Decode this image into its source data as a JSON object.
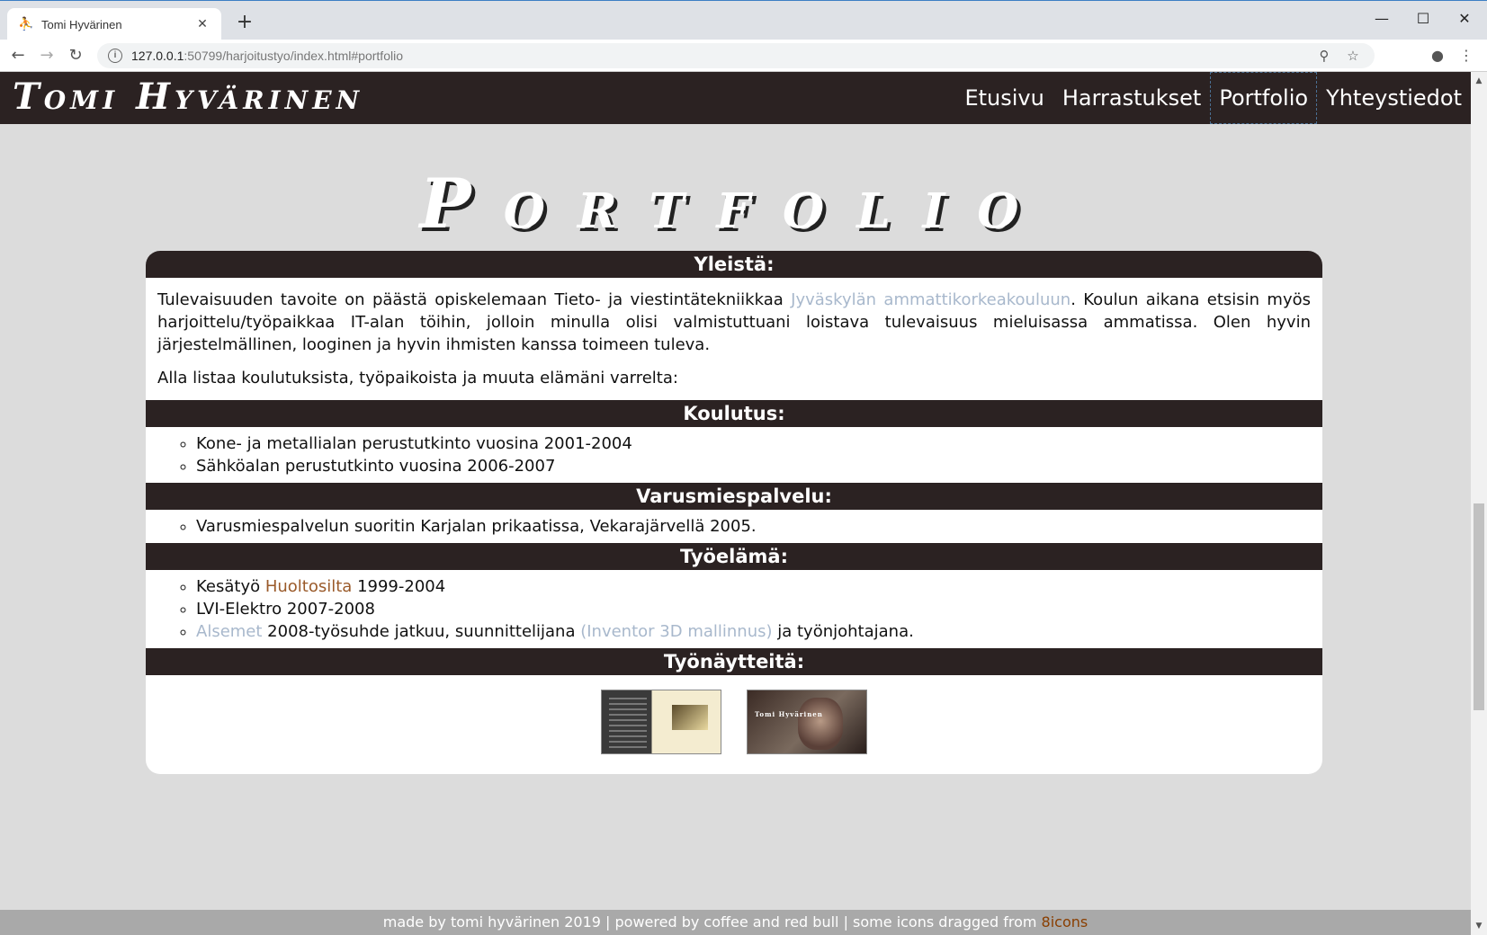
{
  "browser": {
    "tab_title": "Tomi Hyvärinen",
    "tab_close": "✕",
    "new_tab": "+",
    "url_host": "127.0.0.1",
    "url_rest": ":50799/harjoitustyo/index.html#portfolio",
    "info_glyph": "i",
    "icons": {
      "favicon": "runner-icon",
      "back": "arrow-left-icon",
      "forward": "arrow-right-icon",
      "reload": "reload-icon",
      "zoom": "zoom-icon",
      "bookmark": "star-icon",
      "profile": "account-icon",
      "menu": "kebab-menu-icon"
    },
    "glyphs": {
      "favicon": "⛹",
      "back": "←",
      "forward": "→",
      "reload": "↻",
      "zoom": "⚲",
      "bookmark": "☆",
      "profile": "●",
      "menu": "⋮",
      "minimize": "—",
      "maximize": "☐",
      "close": "✕",
      "scroll_up": "▲",
      "scroll_down": "▼"
    }
  },
  "site": {
    "logo": "Tomi Hyvärinen",
    "nav": [
      "Etusivu",
      "Harrastukset",
      "Portfolio",
      "Yhteystiedot"
    ],
    "active_nav": "Portfolio",
    "page_title": "Portfolio"
  },
  "sections": {
    "general": {
      "heading": "Yleistä:",
      "p1_before": "Tulevaisuuden tavoite on päästä opiskelemaan Tieto- ja viestintätekniikkaa ",
      "p1_link": "Jyväskylän ammattikorkeakouluun",
      "p1_after": ". Koulun aikana etsisin myös harjoittelu/työpaikkaa IT-alan töihin, jolloin minulla olisi valmistuttuani loistava tulevaisuus mieluisassa ammatissa. Olen hyvin järjestelmällinen, looginen ja hyvin ihmisten kanssa toimeen tuleva.",
      "p2": "Alla listaa koulutuksista, työpaikoista ja muuta elämäni varrelta:"
    },
    "education": {
      "heading": "Koulutus:",
      "items": [
        "Kone- ja metallialan perustutkinto vuosina 2001-2004",
        "Sähköalan perustutkinto vuosina 2006-2007"
      ]
    },
    "military": {
      "heading": "Varusmiespalvelu:",
      "items": [
        "Varusmiespalvelun suoritin Karjalan prikaatissa, Vekarajärvellä 2005."
      ]
    },
    "work": {
      "heading": "Työelämä:",
      "item1_before": "Kesätyö ",
      "item1_link": "Huoltosilta",
      "item1_after": " 1999-2004",
      "item2": "LVI-Elektro 2007-2008",
      "item3_link": "Alsemet",
      "item3_mid": " 2008-työsuhde jatkuu, suunnittelijana ",
      "item3_link2": "(Inventor 3D mallinnus)",
      "item3_after": " ja työnjohtajana."
    },
    "samples": {
      "heading": "Työnäytteitä:",
      "thumb2_text": "Tomi Hyvärinen"
    }
  },
  "footer": {
    "text": "made by tomi hyvärinen 2019 | powered by coffee and red bull | some icons dragged from ",
    "link": "8icons"
  }
}
